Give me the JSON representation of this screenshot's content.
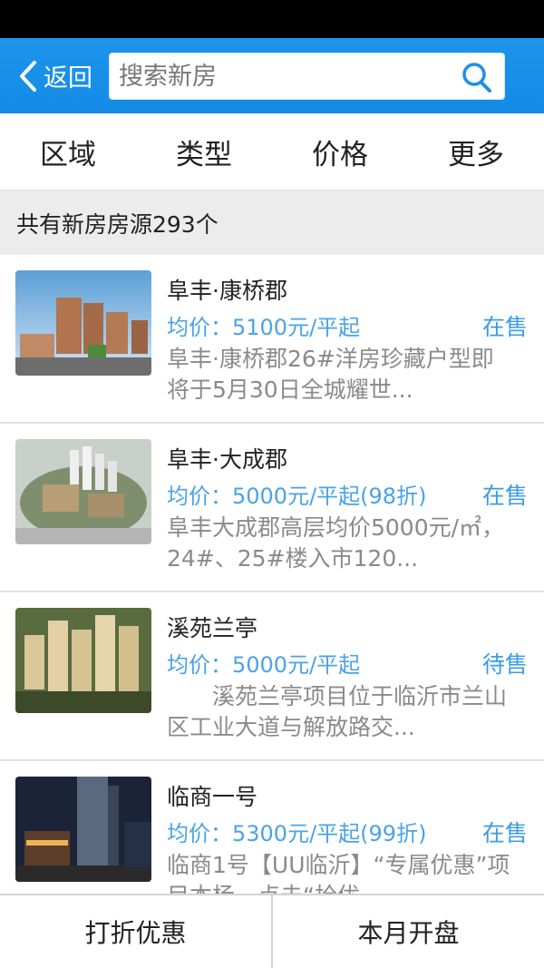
{
  "header": {
    "back_label": "返回",
    "search_placeholder": "搜索新房"
  },
  "filters": [
    {
      "label": "区域"
    },
    {
      "label": "类型"
    },
    {
      "label": "价格"
    },
    {
      "label": "更多"
    }
  ],
  "summary": {
    "count_text": "共有新房房源293个"
  },
  "listings": [
    {
      "title": "阜丰·康桥郡",
      "price": "均价：5100元/平起",
      "status": "在售",
      "description": "阜丰·康桥郡26#洋房珍藏户型即将于5月30日全城耀世..."
    },
    {
      "title": "阜丰·大成郡",
      "price": "均价：5000元/平起(98折)",
      "status": "在售",
      "description": "阜丰大成郡高层均价5000元/㎡，24#、25#楼入市120..."
    },
    {
      "title": "溪苑兰亭",
      "price": "均价：5000元/平起",
      "status": "待售",
      "description": "　　溪苑兰亭项目位于临沂市兰山区工业大道与解放路交..."
    },
    {
      "title": "临商一号",
      "price": "均价：5300元/平起(99折)",
      "status": "在售",
      "description": "临商1号【UU临沂】“专属优惠”项目本杨，点击“抢优"
    }
  ],
  "bottom_tabs": [
    {
      "label": "打折优惠"
    },
    {
      "label": "本月开盘"
    }
  ],
  "colors": {
    "header_blue": "#1e94ea",
    "price_blue": "#4aa3e8",
    "status_blue": "#3b9be6"
  }
}
